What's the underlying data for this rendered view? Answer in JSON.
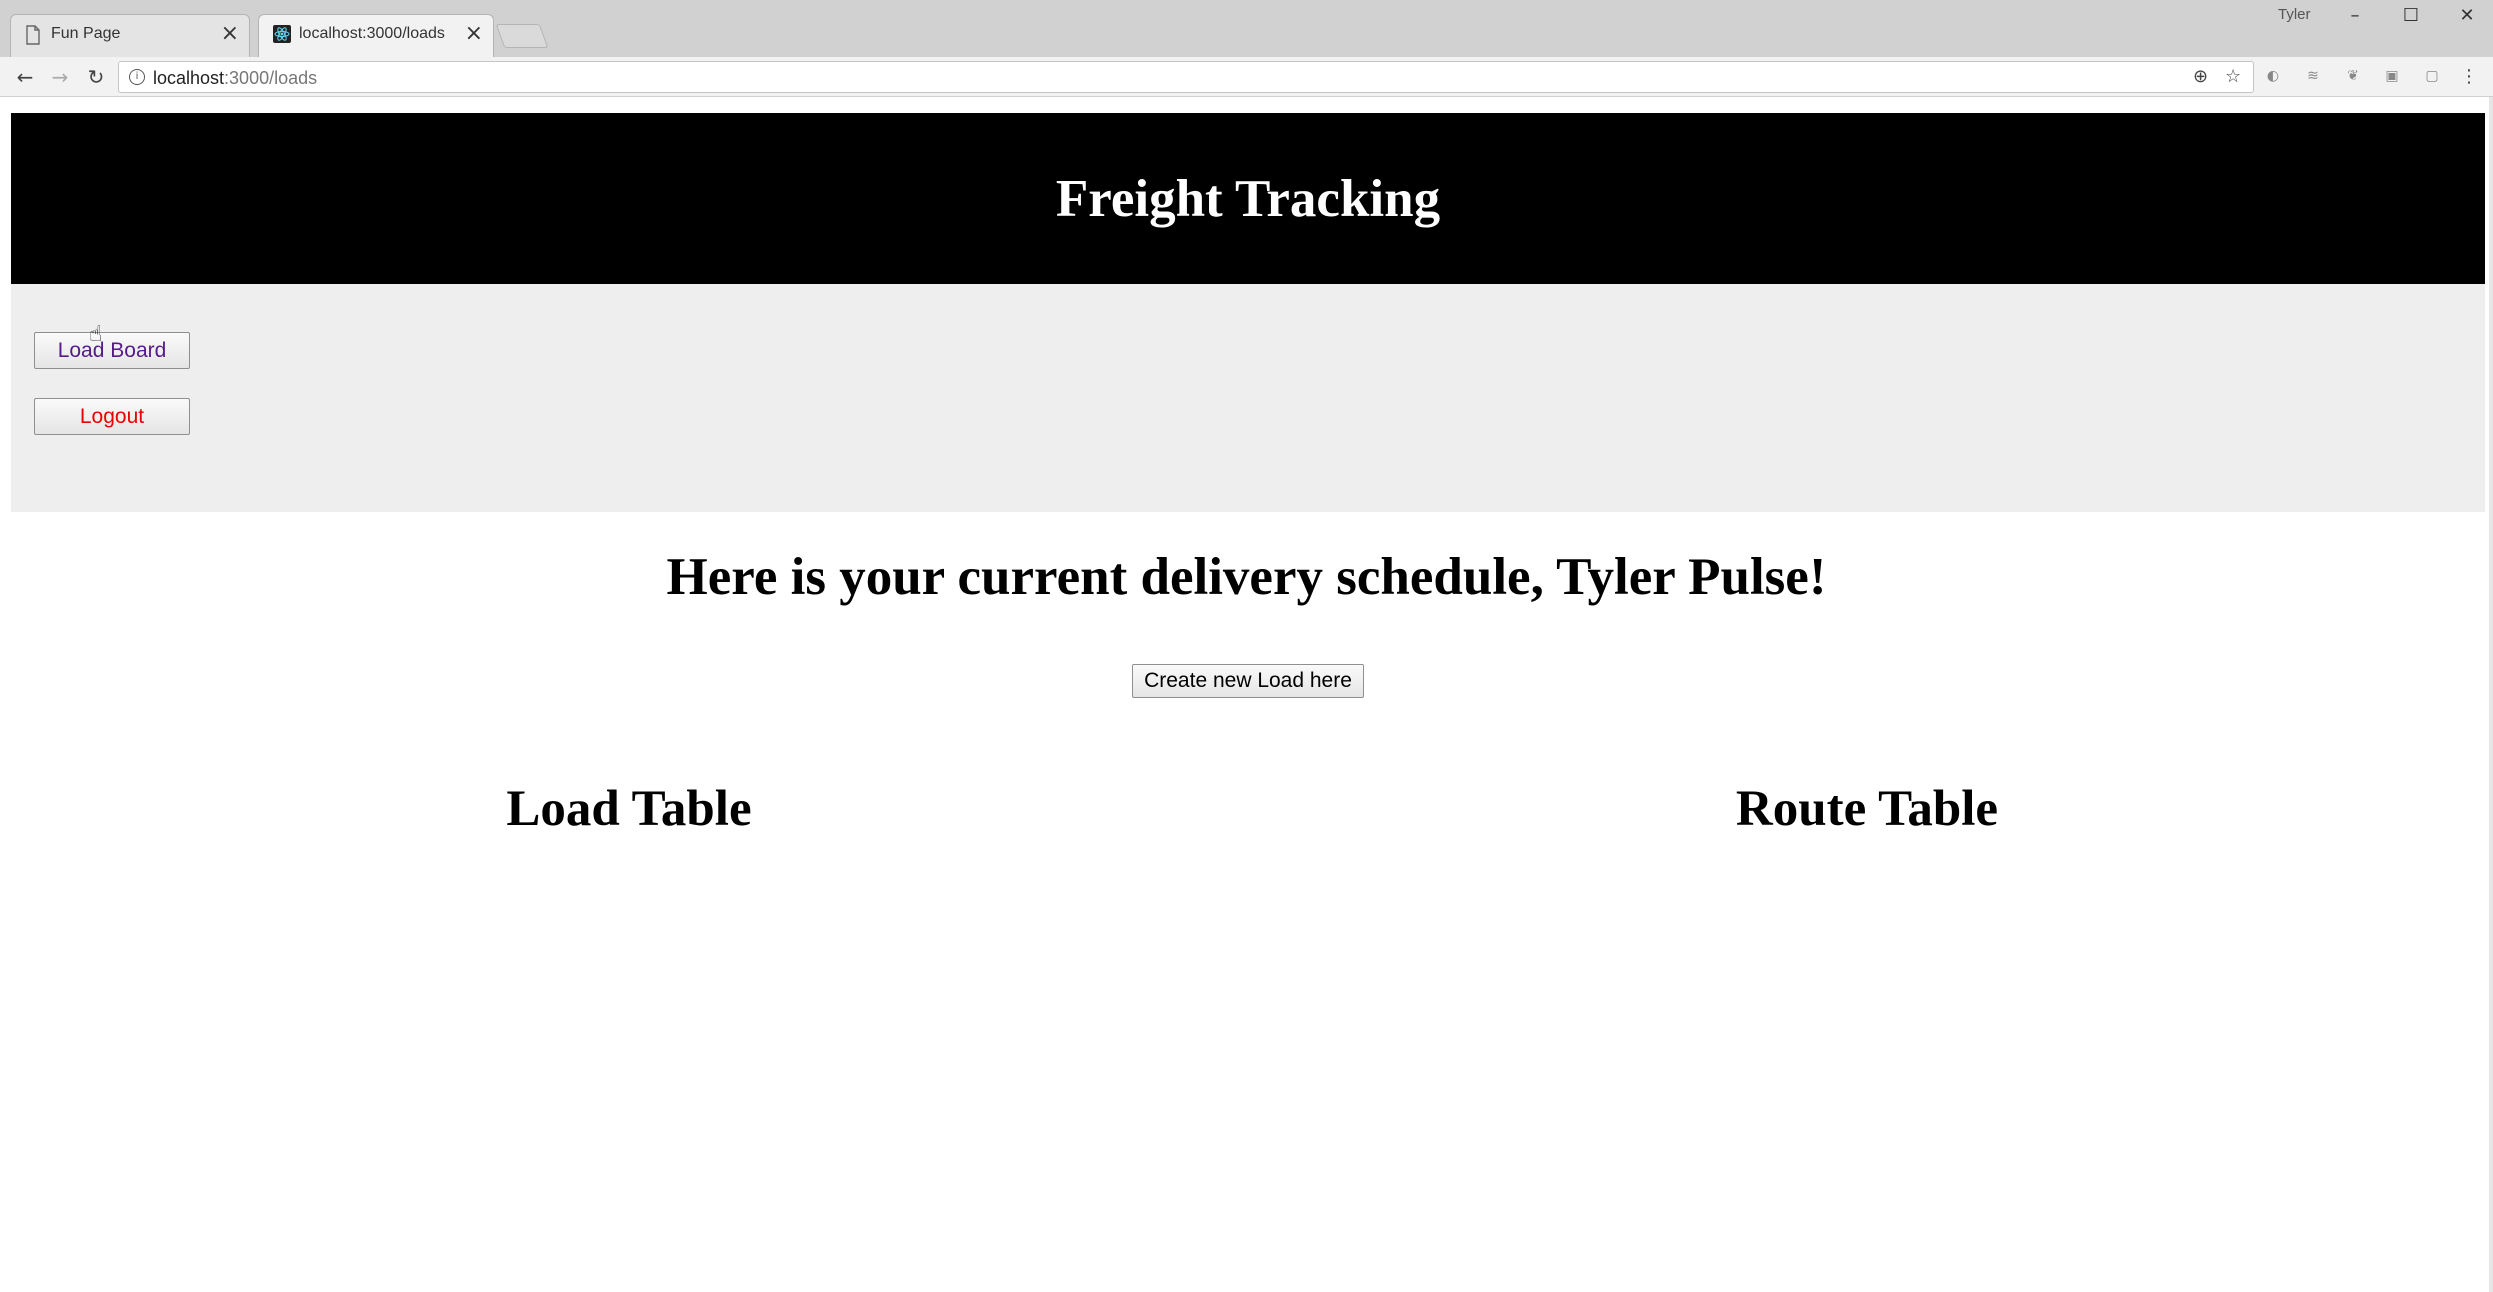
{
  "browser": {
    "tabs": [
      {
        "title": "Fun Page",
        "active": false
      },
      {
        "title": "localhost:3000/loads",
        "active": true
      }
    ],
    "profile_name": "Tyler",
    "url": {
      "host": "localhost",
      "path": ":3000/loads"
    }
  },
  "page": {
    "header_title": "Freight Tracking",
    "nav": {
      "load_board": "Load Board",
      "logout": "Logout"
    },
    "greeting": "Here is your current delivery schedule, Tyler Pulse!",
    "create_button": "Create new Load here",
    "load_table_title": "Load Table",
    "route_table_title": "Route Table"
  },
  "colors": {
    "header_bg": "#000000",
    "nav_bg": "#eeeeee",
    "load_board_text": "#551a8b",
    "logout_text": "#ee0000"
  }
}
